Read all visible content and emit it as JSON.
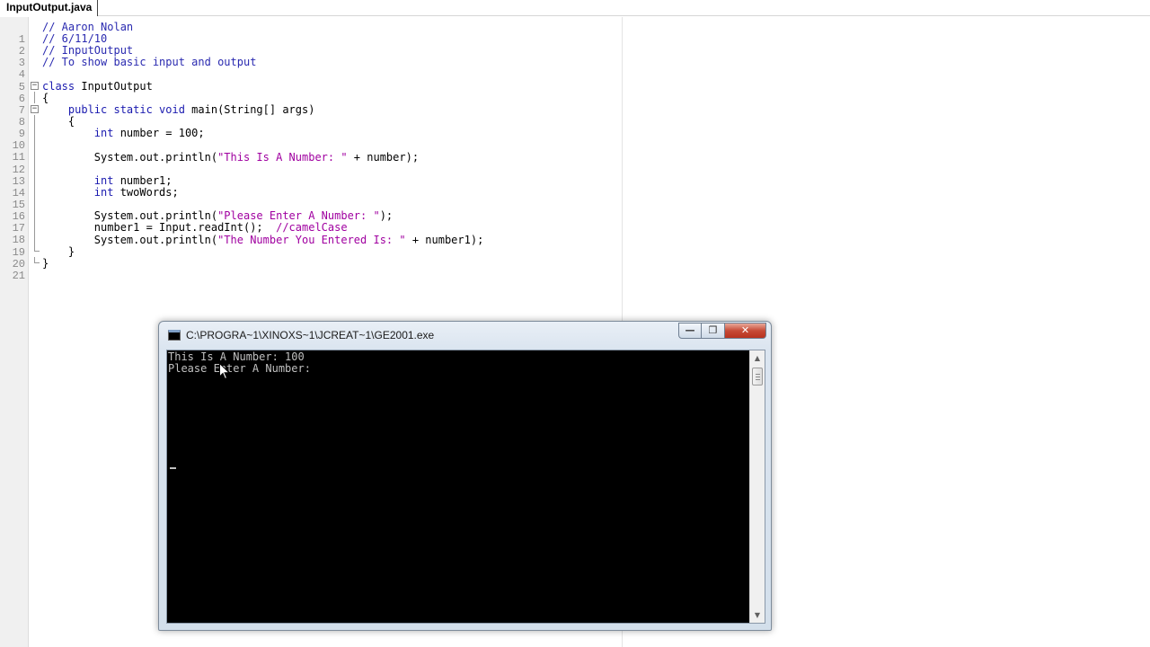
{
  "editor": {
    "tab_title": "InputOutput.java",
    "lines": [
      {
        "num": "1",
        "text": "// Aaron Nolan"
      },
      {
        "num": "2",
        "text": "// 6/11/10"
      },
      {
        "num": "3",
        "text": "// InputOutput"
      },
      {
        "num": "4",
        "text": "// To show basic input and output"
      },
      {
        "num": "5",
        "text": ""
      },
      {
        "num": "6",
        "text": "class InputOutput"
      },
      {
        "num": "7",
        "text": "{"
      },
      {
        "num": "8",
        "text": "    public static void main(String[] args)"
      },
      {
        "num": "9",
        "text": "    {"
      },
      {
        "num": "10",
        "text": "        int number = 100;"
      },
      {
        "num": "11",
        "text": ""
      },
      {
        "num": "12",
        "text": "        System.out.println(\"This Is A Number: \" + number);"
      },
      {
        "num": "13",
        "text": ""
      },
      {
        "num": "14",
        "text": "        int number1;"
      },
      {
        "num": "15",
        "text": "        int twoWords;"
      },
      {
        "num": "16",
        "text": ""
      },
      {
        "num": "17",
        "text": "        System.out.println(\"Please Enter A Number: \");"
      },
      {
        "num": "18",
        "text": "        number1 = Input.readInt();  //camelCase"
      },
      {
        "num": "19",
        "text": "        System.out.println(\"The Number You Entered Is: \" + number1);"
      },
      {
        "num": "20",
        "text": "    }"
      },
      {
        "num": "21",
        "text": "}"
      }
    ]
  },
  "console": {
    "title": "C:\\PROGRA~1\\XINOXS~1\\JCREAT~1\\GE2001.exe",
    "output_lines": [
      "This Is A Number: 100",
      "Please Enter A Number:"
    ],
    "buttons": {
      "minimize": "—",
      "maximize": "❐",
      "close": "✕"
    }
  },
  "icons": {
    "console_icon": "console-window-icon",
    "cursor": "mouse-pointer-icon"
  }
}
